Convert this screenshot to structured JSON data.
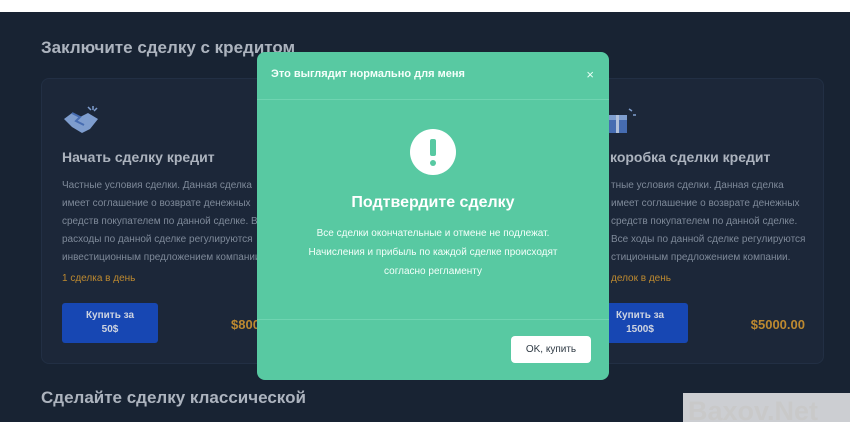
{
  "sections": {
    "credit_title": "Заключите сделку с кредитом",
    "classic_title": "Сделайте сделку классической"
  },
  "cards": {
    "left": {
      "icon": "handshake-icon",
      "title": "Начать сделку кредит",
      "description": "Частные условия сделки. Данная сделка имеет соглашение о возврате денежных средств покупателем по данной сделке. Все расходы по данной сделке регулируются инвестиционным предложением компании.",
      "limit": "1 сделка в день",
      "buy_line1": "Купить за",
      "buy_line2": "50$",
      "price": "$800"
    },
    "right": {
      "icon": "gift-box-icon",
      "title": "коробка сделки кредит",
      "description": "тные условия сделки. Данная сделка имеет соглашение о возврате денежных средств покупателем по данной сделке. Все ходы по данной сделке регулируются стиционным предложением компании.",
      "limit": "делок в день",
      "buy_line1": "Купить за",
      "buy_line2": "1500$",
      "price": "$5000.00"
    }
  },
  "modal": {
    "header_title": "Это выглядит нормально для меня",
    "close_symbol": "×",
    "icon": "exclamation-circle-icon",
    "title": "Подтвердите сделку",
    "body_line1": "Все сделки окончательные и отмене не подлежат.",
    "body_line2": "Начисления и прибыль по каждой сделке происходят",
    "body_line3": "согласно регламенту",
    "ok_label": "OK, купить"
  },
  "watermark": "Baxov.Net",
  "colors": {
    "background": "#1b2637",
    "modal": "#58c9a2",
    "accent_button": "#1a4fc9",
    "price": "#d69a34"
  }
}
